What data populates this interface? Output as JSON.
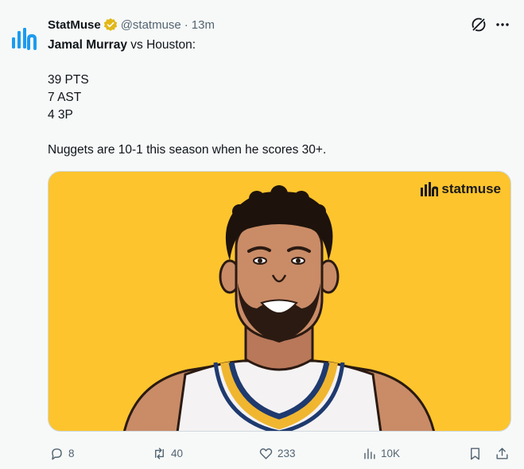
{
  "author": {
    "name": "StatMuse",
    "handle": "@statmuse",
    "separator": "·",
    "time": "13m"
  },
  "tweet": {
    "line1_bold": "Jamal Murray",
    "line1_rest": " vs Houston:",
    "stats": [
      "39 PTS",
      "7 AST",
      "4 3P"
    ],
    "summary": "Nuggets are 10-1 this season when he scores 30+."
  },
  "media": {
    "watermark": "statmuse",
    "background": "#fdc42d"
  },
  "actions": {
    "replies": "8",
    "reposts": "40",
    "likes": "233",
    "views": "10K"
  },
  "colors": {
    "verified_badge": "#e2b719",
    "logo_blue": "#1d9bf0",
    "muted_text": "#536471"
  }
}
